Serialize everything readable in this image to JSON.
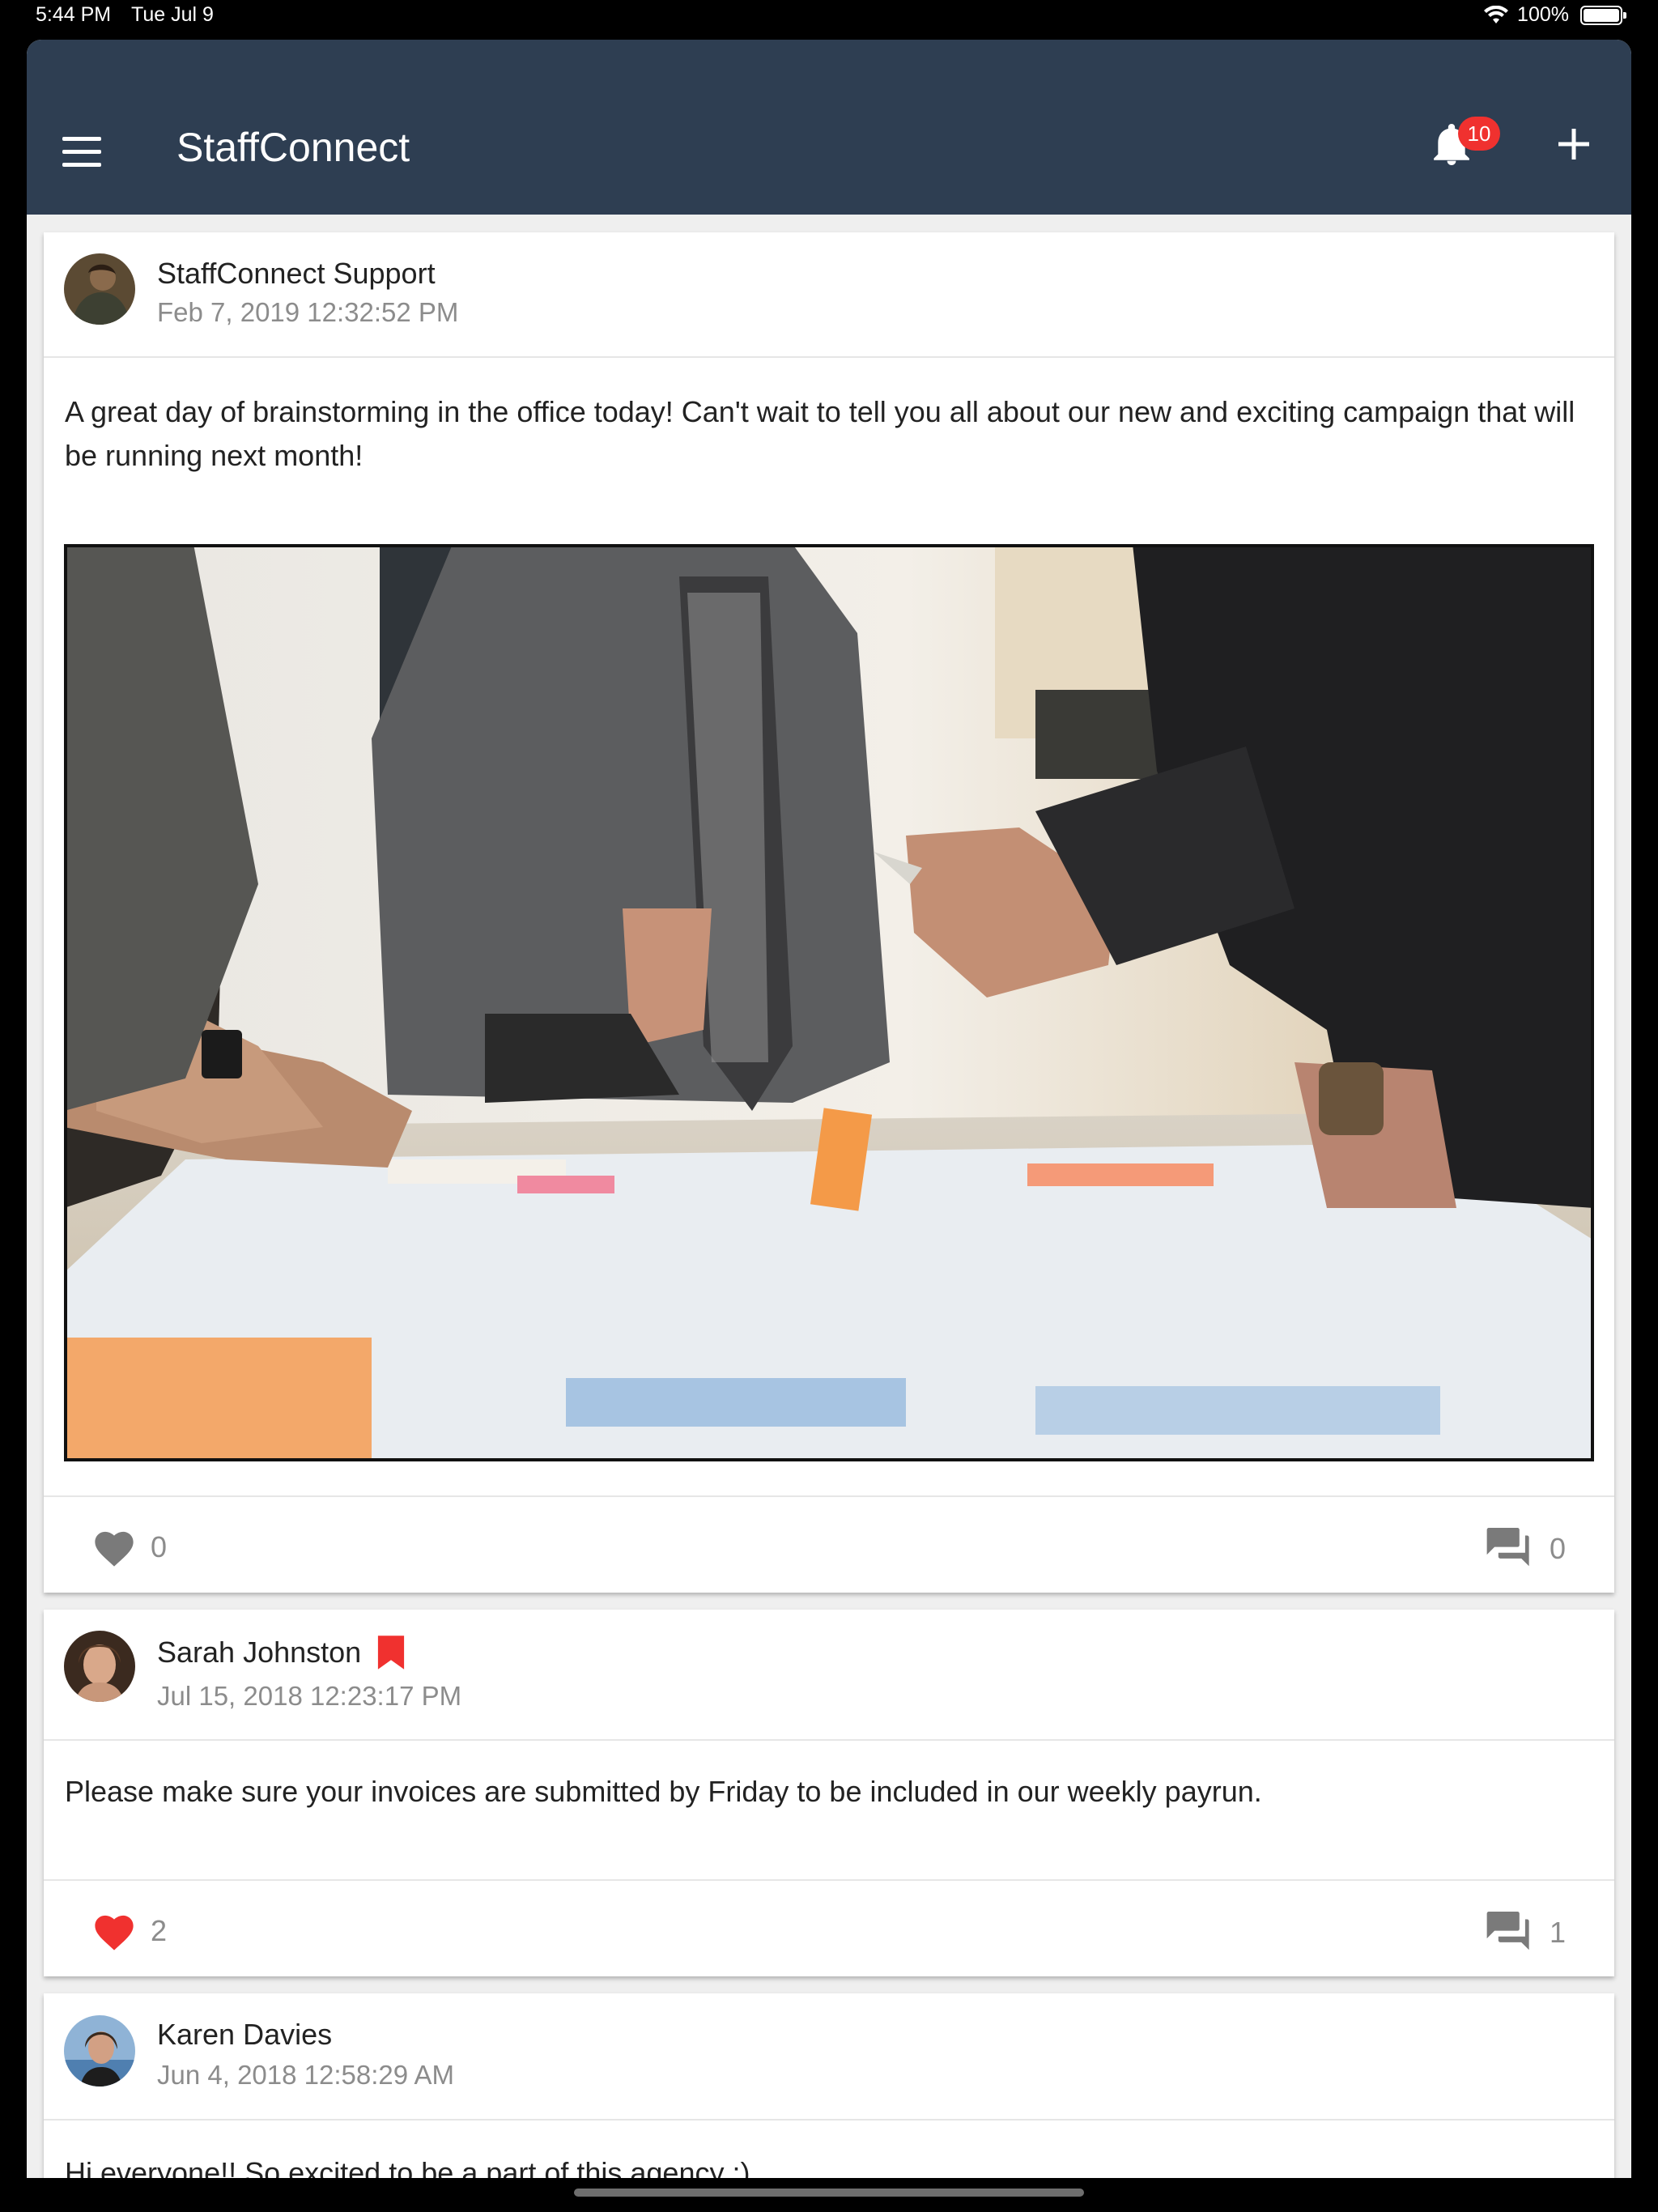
{
  "status_bar": {
    "time": "5:44 PM",
    "date": "Tue Jul 9",
    "battery": "100%",
    "icons": [
      "wifi-icon",
      "battery-icon"
    ]
  },
  "app_bar": {
    "title": "StaffConnect",
    "notification_count": "10",
    "icons": [
      "menu-icon",
      "bell-icon",
      "plus-icon"
    ],
    "colors": {
      "bar": "#2e3e52",
      "badge": "#f0312f"
    }
  },
  "posts": [
    {
      "author": "StaffConnect Support",
      "timestamp": "Feb 7, 2019 12:32:52 PM",
      "text": "A great day of brainstorming in the office today! Can't wait to tell you all about our new and exciting campaign that will be running next month!",
      "likes": "0",
      "comments": "0",
      "liked": false,
      "has_photo": true
    },
    {
      "author": "Sarah Johnston",
      "timestamp": "Jul 15, 2018 12:23:17 PM",
      "text": "Please make sure your invoices are submitted by Friday to be included in our weekly payrun.",
      "likes": "2",
      "comments": "1",
      "liked": true,
      "bookmarked": true
    },
    {
      "author": "Karen Davies",
      "timestamp": "Jun 4, 2018 12:58:29 AM",
      "text": "Hi everyone!! So excited to be a part of this agency :)"
    }
  ],
  "colors": {
    "liked": "#f0312f",
    "unliked": "#7a7a7a",
    "bookmark": "#f0312f"
  }
}
